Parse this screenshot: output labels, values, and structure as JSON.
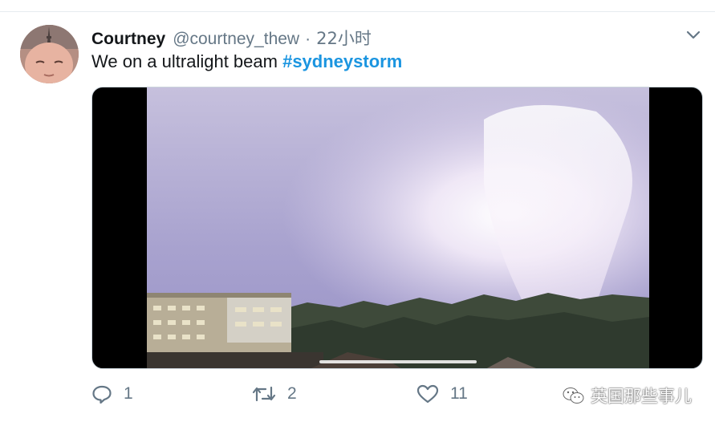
{
  "tweet": {
    "display_name": "Courtney",
    "handle": "@courtney_thew",
    "separator": "·",
    "time": "22小时",
    "text": "We on a ultralight beam",
    "hashtag": "#sydneystorm"
  },
  "actions": {
    "reply_count": "1",
    "retweet_count": "2",
    "like_count": "11"
  },
  "watermark": {
    "text": "英国那些事儿"
  },
  "colors": {
    "hashtag": "#1b95e0",
    "muted": "#657786",
    "text": "#14171a"
  },
  "icons": {
    "reply": "reply-icon",
    "retweet": "retweet-icon",
    "like": "heart-icon",
    "caret": "chevron-down-icon",
    "watermark": "wechat-icon"
  }
}
